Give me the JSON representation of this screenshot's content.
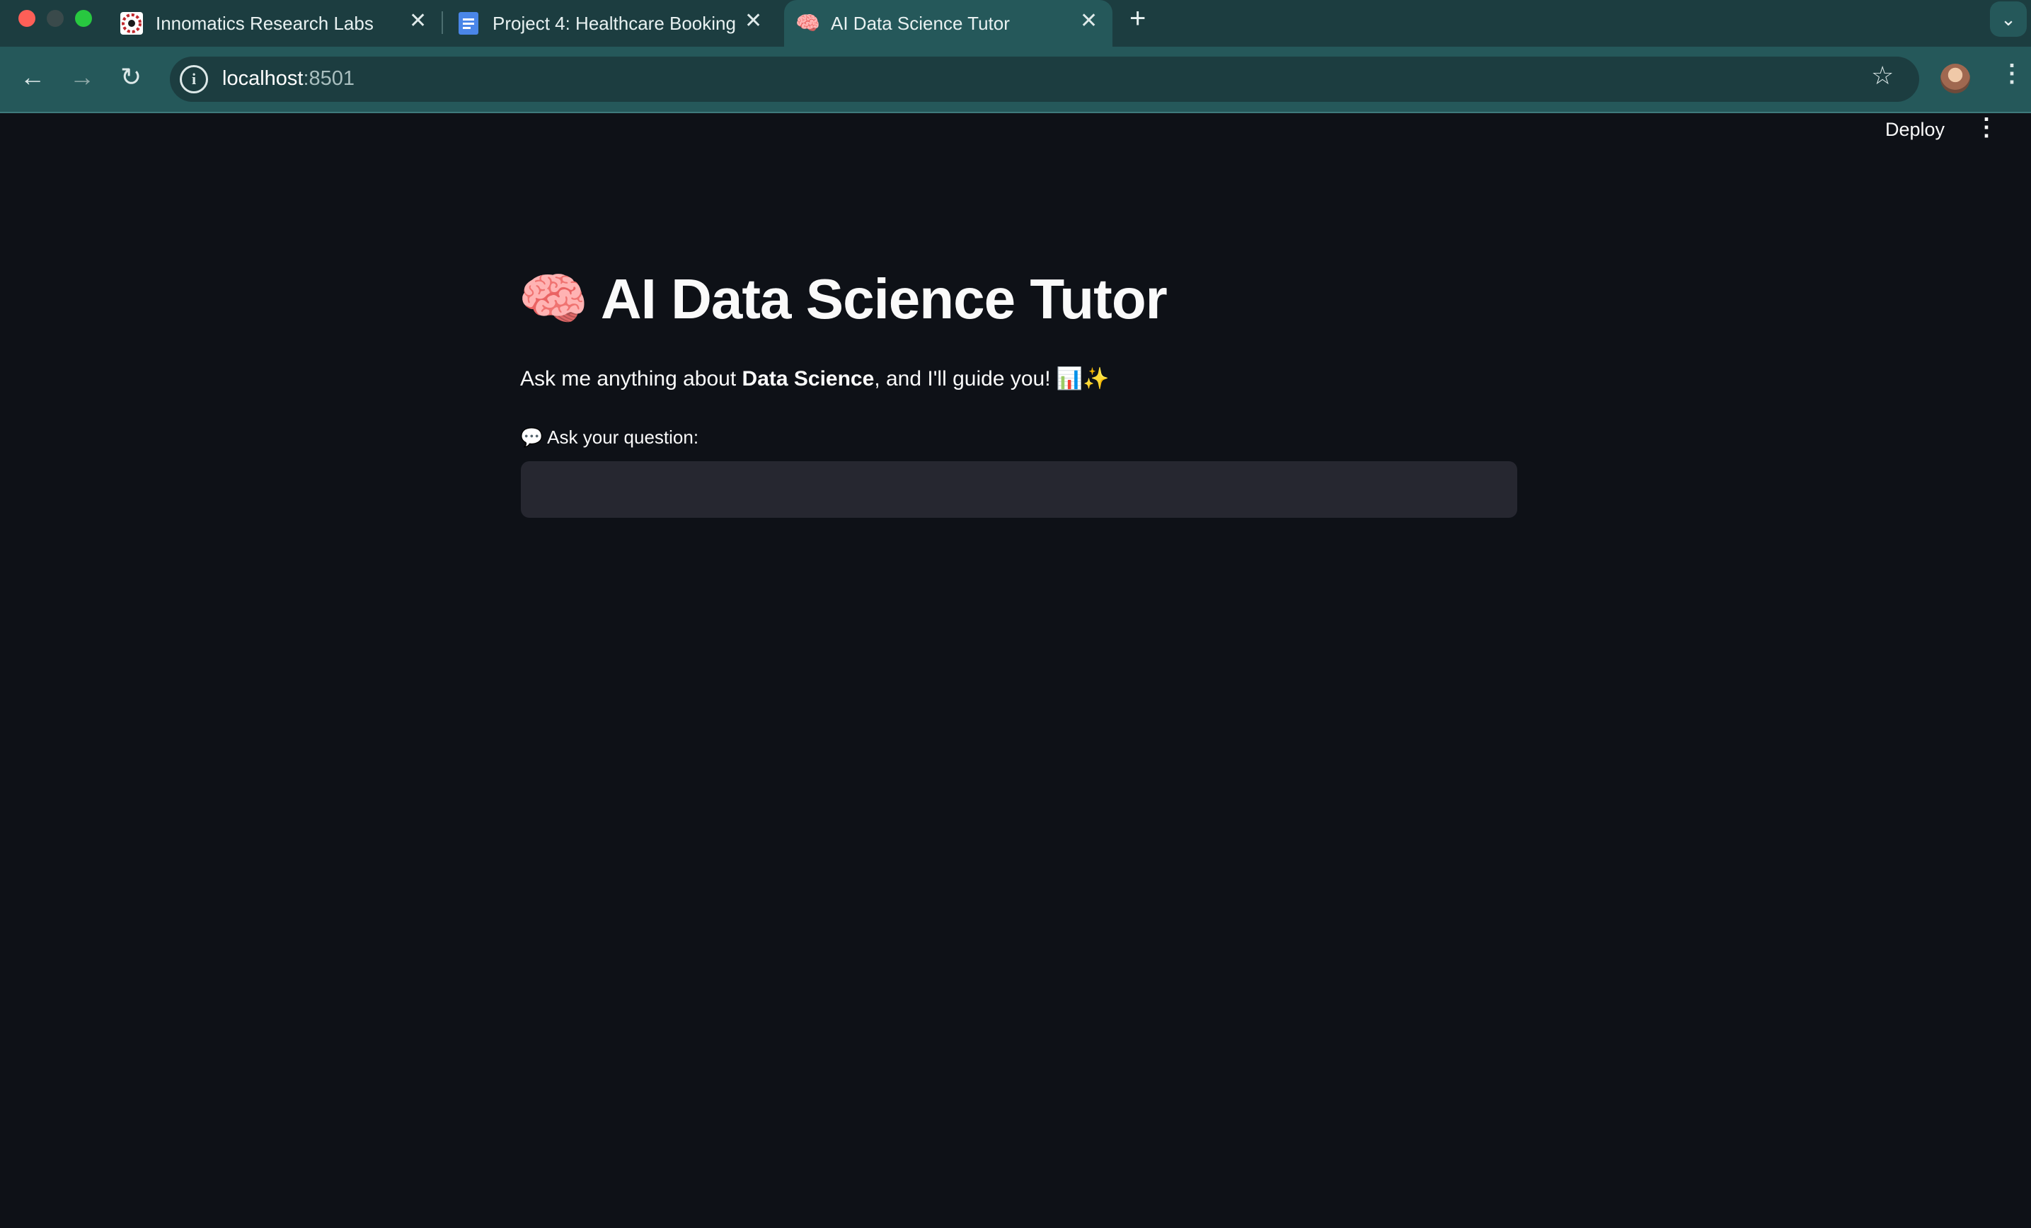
{
  "browser": {
    "tabs": [
      {
        "label": "Innomatics Research Labs",
        "favicon": "innomatics-logo",
        "active": false
      },
      {
        "label": "Project 4: Healthcare Booking",
        "favicon": "google-docs-icon",
        "active": false
      },
      {
        "label": "AI Data Science Tutor",
        "favicon": "brain-emoji",
        "active": true
      }
    ],
    "url_host": "localhost",
    "url_port": ":8501"
  },
  "app": {
    "deploy_label": "Deploy",
    "title_emoji": "🧠",
    "title": "AI Data Science Tutor",
    "subtitle_pre": "Ask me anything about ",
    "subtitle_bold": "Data Science",
    "subtitle_post": ", and I'll guide you! 📊✨",
    "question_label": "💬 Ask your question:",
    "question_value": ""
  },
  "colors": {
    "background": "#0e1117",
    "tabstrip": "#1c3d40",
    "toolbar": "#25585a",
    "input_bg": "#262730",
    "text": "#fafafa"
  }
}
